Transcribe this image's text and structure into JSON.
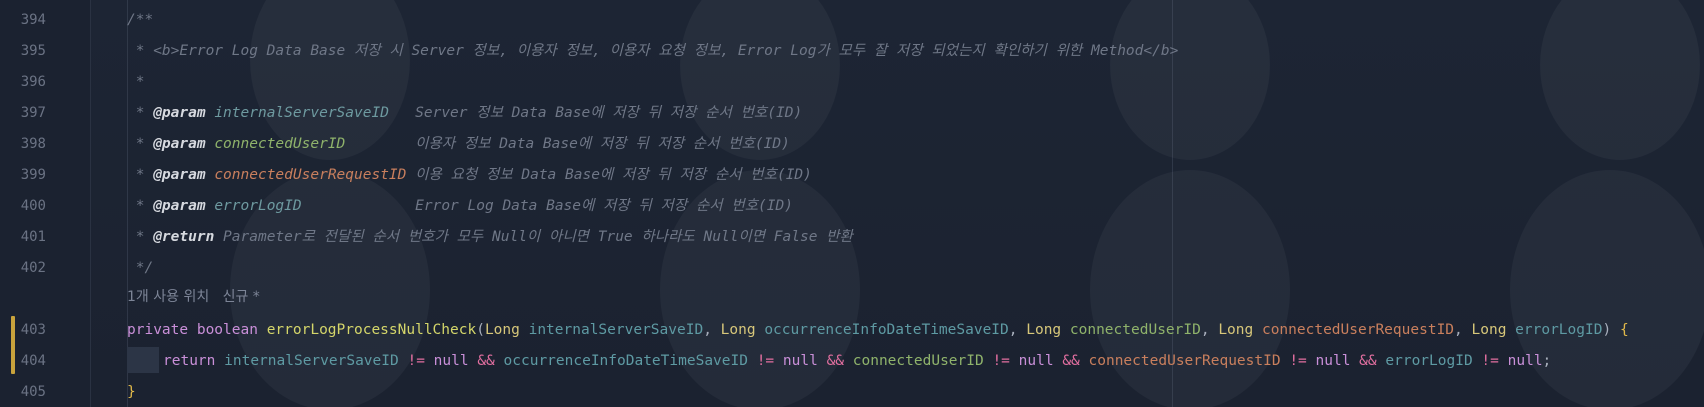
{
  "gutter": {
    "line_numbers": [
      "394",
      "395",
      "396",
      "397",
      "398",
      "399",
      "400",
      "401",
      "402",
      "403",
      "404",
      "405"
    ]
  },
  "javadoc": {
    "open": "/**",
    "summary": " * <b>Error Log Data Base 저장 시 Server 정보, 이용자 정보, 이용자 요청 정보, Error Log가 모두 잘 저장 되었는지 확인하기 위한 Method</b>",
    "blank": " *",
    "params": [
      {
        "tag": "@param",
        "name": "internalServerSaveID",
        "pad": "   ",
        "desc": "Server 정보 Data Base에 저장 뒤 저장 순서 번호(ID)"
      },
      {
        "tag": "@param",
        "name": "connectedUserID",
        "pad": "        ",
        "desc": "이용자 정보 Data Base에 저장 뒤 저장 순서 번호(ID)"
      },
      {
        "tag": "@param",
        "name": "connectedUserRequestID",
        "pad": " ",
        "desc": "이용 요청 정보 Data Base에 저장 뒤 저장 순서 번호(ID)"
      },
      {
        "tag": "@param",
        "name": "errorLogID",
        "pad": "             ",
        "desc": "Error Log Data Base에 저장 뒤 저장 순서 번호(ID)"
      }
    ],
    "return_tag": "@return",
    "return_desc": "Parameter로 전달된 순서 번호가 모두 Null이 아니면 True 하나라도 Null이면 False 반환",
    "close": " */"
  },
  "inlay_hint": {
    "usages": "1개 사용 위치",
    "author": "신규 *"
  },
  "signature": {
    "modifier": "private",
    "return_type": "boolean",
    "method": "errorLogProcessNullCheck",
    "params": [
      {
        "type": "Long",
        "name": "internalServerSaveID"
      },
      {
        "type": "Long",
        "name": "occurrenceInfoDateTimeSaveID"
      },
      {
        "type": "Long",
        "name": "connectedUserID"
      },
      {
        "type": "Long",
        "name": "connectedUserRequestID"
      },
      {
        "type": "Long",
        "name": "errorLogID"
      }
    ]
  },
  "body": {
    "return_kw": "return",
    "checks": [
      "internalServerSaveID",
      "occurrenceInfoDateTimeSaveID",
      "connectedUserID",
      "connectedUserRequestID",
      "errorLogID"
    ],
    "neq": "!=",
    "null_kw": "null",
    "and": "&&"
  },
  "closing_brace": "}",
  "colors": {
    "background": "#1c2331",
    "keyword": "#c98fd8",
    "type": "#d7c77a",
    "method": "#d4d66a",
    "brace": "#e0b94a",
    "doc_comment": "#6f7787",
    "change_marker": "#c9a33c"
  }
}
